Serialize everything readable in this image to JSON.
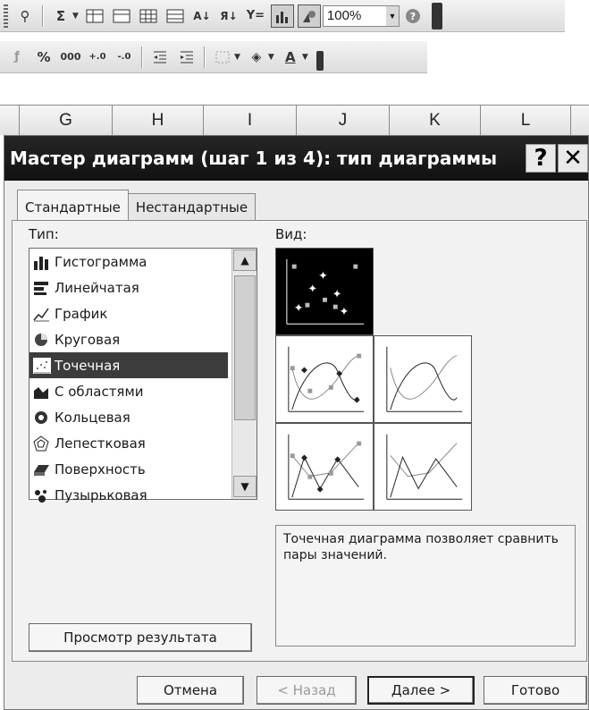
{
  "toolbar1": {
    "zoom": "100%"
  },
  "toolbar2": {
    "percent": "%",
    "thousands": "000"
  },
  "columns": [
    "G",
    "H",
    "I",
    "J",
    "K",
    "L"
  ],
  "dialog": {
    "title": "Мастер диаграмм (шаг 1 из 4): тип диаграммы",
    "help_label": "?",
    "close_label": "✕",
    "tabs": [
      {
        "label": "Стандартные",
        "active": true
      },
      {
        "label": "Нестандартные",
        "active": false
      }
    ],
    "type_label": "Тип:",
    "view_label": "Вид:",
    "chart_types": [
      {
        "label": "Гистограмма",
        "icon": "column-chart-icon"
      },
      {
        "label": "Линейчатая",
        "icon": "bar-chart-icon"
      },
      {
        "label": "График",
        "icon": "line-chart-icon"
      },
      {
        "label": "Круговая",
        "icon": "pie-chart-icon"
      },
      {
        "label": "Точечная",
        "icon": "scatter-chart-icon",
        "selected": true
      },
      {
        "label": "С областями",
        "icon": "area-chart-icon"
      },
      {
        "label": "Кольцевая",
        "icon": "doughnut-chart-icon"
      },
      {
        "label": "Лепестковая",
        "icon": "radar-chart-icon"
      },
      {
        "label": "Поверхность",
        "icon": "surface-chart-icon"
      },
      {
        "label": "Пузырьковая",
        "icon": "bubble-chart-icon"
      }
    ],
    "description": "Точечная диаграмма позволяет сравнить пары значений.",
    "preview_button": "Просмотр результата",
    "buttons": {
      "cancel": "Отмена",
      "back": "< Назад",
      "next": "Далее >",
      "finish": "Готово"
    }
  },
  "colors": {
    "titlebar": "#111111",
    "selection": "#3c3c3c"
  }
}
